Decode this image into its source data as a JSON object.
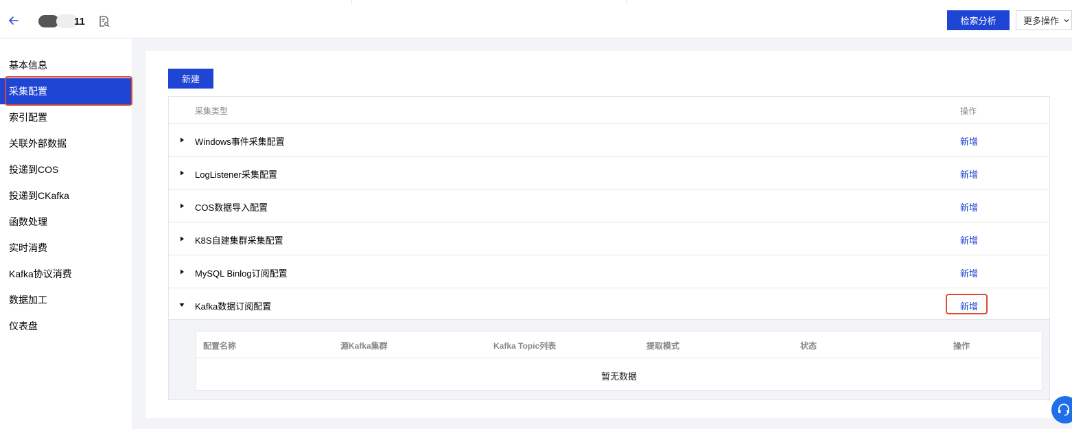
{
  "header": {
    "title_suffix": "11",
    "search_button": "检索分析",
    "more_button": "更多操作"
  },
  "sidebar": {
    "items": [
      {
        "label": "基本信息"
      },
      {
        "label": "采集配置",
        "active": true
      },
      {
        "label": "索引配置"
      },
      {
        "label": "关联外部数据"
      },
      {
        "label": "投递到COS"
      },
      {
        "label": "投递到CKafka"
      },
      {
        "label": "函数处理"
      },
      {
        "label": "实时消费"
      },
      {
        "label": "Kafka协议消费"
      },
      {
        "label": "数据加工"
      },
      {
        "label": "仪表盘"
      }
    ]
  },
  "main": {
    "new_button": "新建",
    "table": {
      "columns": {
        "type": "采集类型",
        "action": "操作"
      },
      "rows": [
        {
          "label": "Windows事件采集配置",
          "action": "新增",
          "expanded": false
        },
        {
          "label": "LogListener采集配置",
          "action": "新增",
          "expanded": false
        },
        {
          "label": "COS数据导入配置",
          "action": "新增",
          "expanded": false
        },
        {
          "label": "K8S自建集群采集配置",
          "action": "新增",
          "expanded": false
        },
        {
          "label": "MySQL Binlog订阅配置",
          "action": "新增",
          "expanded": false
        },
        {
          "label": "Kafka数据订阅配置",
          "action": "新增",
          "expanded": true
        }
      ]
    },
    "subtable": {
      "columns": [
        "配置名称",
        "源Kafka集群",
        "Kafka Topic列表",
        "提取模式",
        "状态",
        "操作"
      ],
      "empty_text": "暂无数据"
    }
  },
  "colors": {
    "primary": "#1f45d4",
    "highlight": "#e0492c",
    "link": "#1f45d4",
    "content_bg": "#f3f4f7"
  },
  "icons": {
    "back": "arrow-left-icon",
    "doc": "doc-search-icon",
    "more": "chevron-down-icon",
    "collapsed": "caret-right-icon",
    "expanded": "caret-down-icon",
    "help": "headset-icon"
  }
}
